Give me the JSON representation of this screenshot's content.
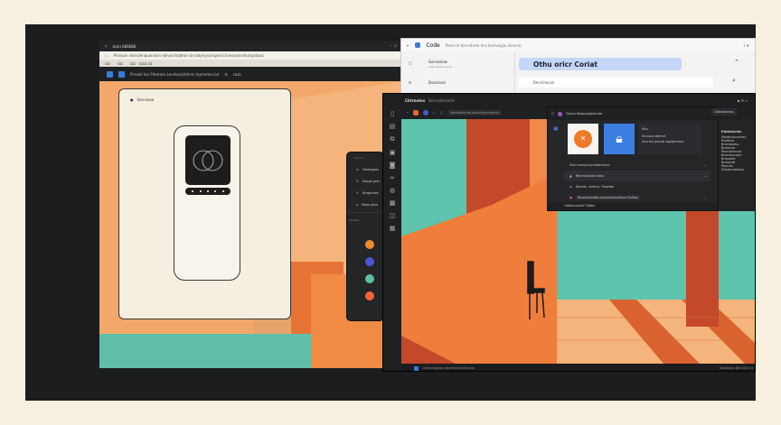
{
  "window1": {
    "title": "ɪɪɪɑɑ ɓɓɓɓɓɓ",
    "address": "Piroouin nbisulenquonasin ebivuichabhon bn bbyriyusingrsiic bvosssonchunqnbooc",
    "bookmarks": [
      "ɪɪɪɪ",
      "ɪɪɪɪ",
      "ɪɪɪɪ · ɪɪɪɪɪɪ ɪɪɪ"
    ],
    "toolbar_text": "Priveel tov Ftbetom Lendvenjrbhinn tspnmten bd",
    "toolbar_extra": "ɪɪɪɪɪɪ",
    "card_title": "Sssnsuoe"
  },
  "popup": {
    "header": "ɪɪɪ ɪɪ ɪɪ",
    "items": [
      "Berbogoin",
      "Eeogs-gmn",
      "Bregerbes",
      "Beon-gmn"
    ],
    "section": "ɪɪɪɪɪɪɪɪɪɪ",
    "swatches": [
      "#f28a2e",
      "#4a55d8",
      "#5ebfa6",
      "#ee6532"
    ]
  },
  "window2": {
    "title": "Code",
    "subtitle": "Penvcin tbvrsdarte dre techvoigia denvim.",
    "sidebar": [
      {
        "label": "Sonnatiew",
        "sub": "Lobu Sbett ivarts"
      },
      {
        "label": "Dsssinsss"
      }
    ],
    "assistant_pill": "Othu oricr Coriat",
    "search_placeholder": "Bevrchouse"
  },
  "window3": {
    "title": "Chtrnates",
    "subtitle": "Bcsrosbrsiniris",
    "path_field": "sbecbsdtuqsurpoptrigyvnppnb",
    "panel_header": "Sossrcdtsppgipgdpnbe",
    "right_button": "Cbstsdsnnss",
    "card_lines": [
      "Sbu",
      "Snuuvo sbenvt",
      "Ssurtvs pvovb sigvbpnstvr"
    ],
    "rows": [
      "Sbb nvnlosuvyrsbbmnvro",
      "Rbvrnouviaa sbso",
      "Bouvts, durhsv, Fbsetbe",
      "Boasivpsvbbs psvpsstbhvbisve Buttbs",
      "Sbsvbv"
    ],
    "panel_footer": "Obbbvnuvhb Tbbtb",
    "right_panel_title": "Rbbtstsnbs",
    "right_panel_items": [
      "Nbvbnvsuvrvav",
      "Pnsfbeb",
      "Bresibovbu",
      "Bnsbvnb",
      "Pbvrsbvnsvb",
      "Breshvnusbn",
      "Bressbrb",
      "Bnsbvnb",
      "Pbvnsb",
      "Dnrsbvnsbsvp"
    ],
    "status_left": "Crbvrcdypvas sbverhyvnssfvaran",
    "status_right": "Dbnbsbss 88:4101 ct"
  },
  "colors": {
    "teal": "#5ec4ad",
    "orange": "#f08a44",
    "rust": "#c4482a",
    "peach": "#f5b47b",
    "accent_blue": "#3a7bd5"
  }
}
